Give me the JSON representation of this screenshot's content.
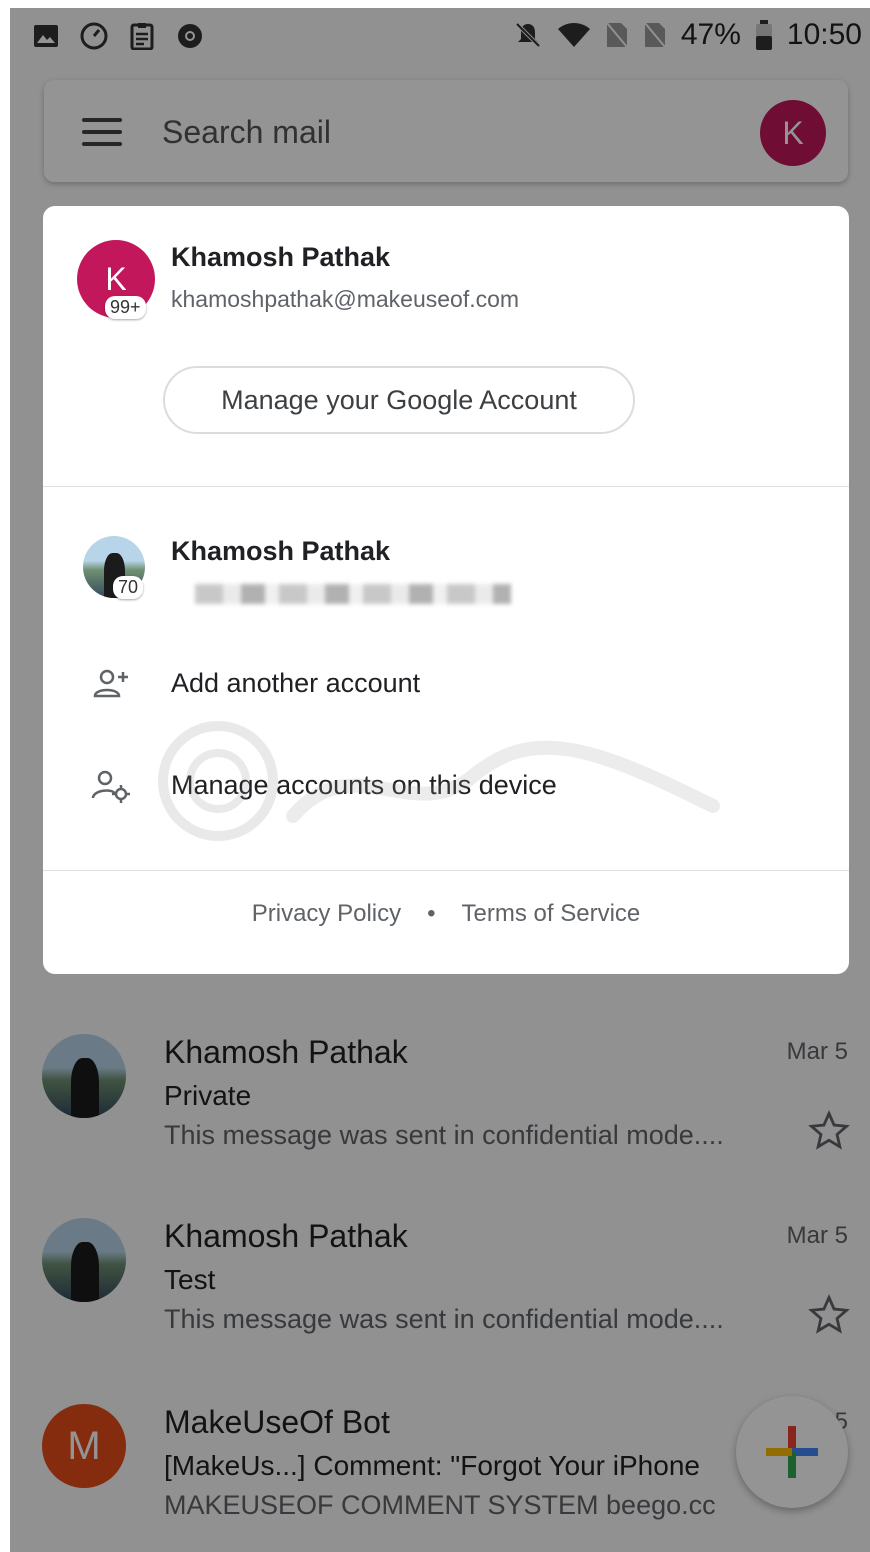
{
  "status_bar": {
    "battery": "47%",
    "time": "10:50"
  },
  "search": {
    "placeholder": "Search mail",
    "avatar_letter": "K"
  },
  "account_card": {
    "primary": {
      "avatar_letter": "K",
      "badge": "99+",
      "name": "Khamosh Pathak",
      "email": "khamoshpathak@makeuseof.com"
    },
    "manage_button": "Manage your Google Account",
    "secondary": {
      "badge": "70",
      "name": "Khamosh Pathak"
    },
    "menu": [
      {
        "label": "Add another account",
        "icon": "add-person-icon"
      },
      {
        "label": "Manage accounts on this device",
        "icon": "manage-accounts-icon"
      }
    ],
    "footer": {
      "privacy": "Privacy Policy",
      "separator": "•",
      "terms": "Terms of Service"
    }
  },
  "mail_list": [
    {
      "sender": "Khamosh Pathak",
      "date": "Mar 5",
      "subject": "Private",
      "preview": "This message was sent in confidential mode...."
    },
    {
      "sender": "Khamosh Pathak",
      "date": "Mar 5",
      "subject": "Test",
      "preview": "This message was sent in confidential mode...."
    },
    {
      "sender": "MakeUseOf Bot",
      "avatar_letter": "M",
      "date": "5",
      "subject": "[MakeUs...] Comment: \"Forgot Your iPhone",
      "preview": "MAKEUSEOF COMMENT SYSTEM beego.cc"
    }
  ],
  "colors": {
    "primary_avatar": "#c2185b",
    "bot_avatar": "#e64a19",
    "scrim": "rgba(0,0,0,0.42)"
  }
}
